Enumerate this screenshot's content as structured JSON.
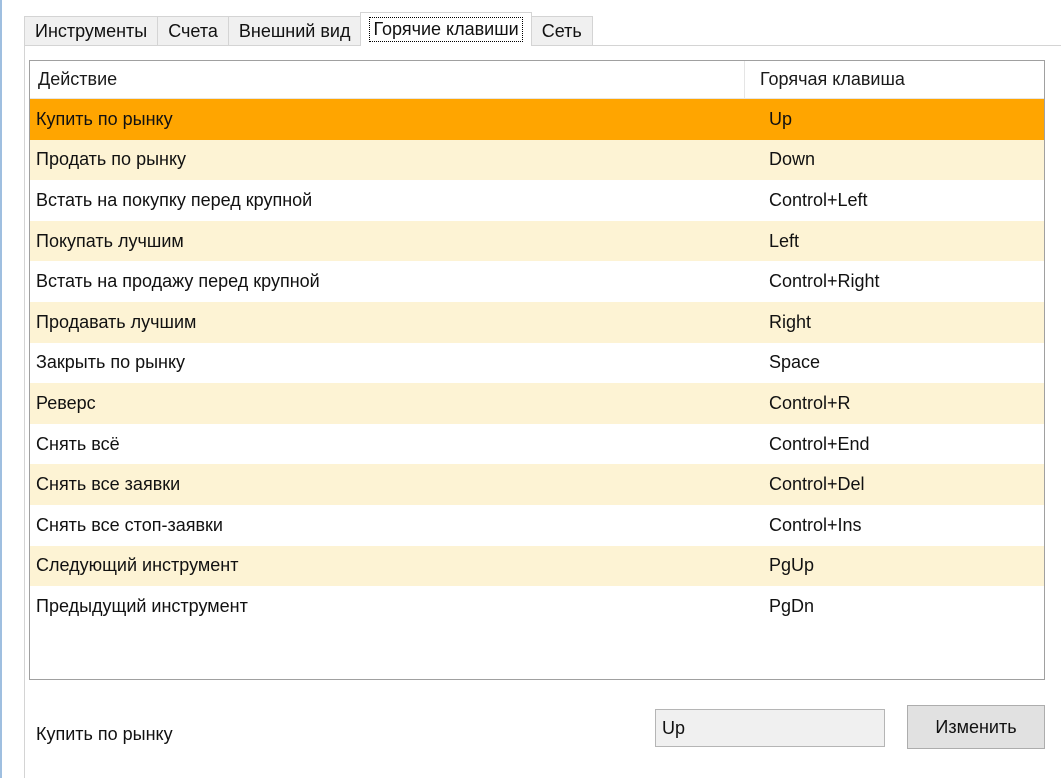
{
  "tabs": [
    {
      "label": "Инструменты",
      "active": false
    },
    {
      "label": "Счета",
      "active": false
    },
    {
      "label": "Внешний вид",
      "active": false
    },
    {
      "label": "Горячие клавиши",
      "active": true
    },
    {
      "label": "Сеть",
      "active": false
    }
  ],
  "table": {
    "headers": {
      "action": "Действие",
      "hotkey": "Горячая клавиша"
    },
    "selected_index": 0,
    "rows": [
      {
        "action": "Купить по рынку",
        "hotkey": "Up"
      },
      {
        "action": "Продать по рынку",
        "hotkey": "Down"
      },
      {
        "action": "Встать на покупку перед крупной",
        "hotkey": "Control+Left"
      },
      {
        "action": "Покупать лучшим",
        "hotkey": "Left"
      },
      {
        "action": "Встать на продажу перед крупной",
        "hotkey": "Control+Right"
      },
      {
        "action": "Продавать лучшим",
        "hotkey": "Right"
      },
      {
        "action": "Закрыть по рынку",
        "hotkey": "Space"
      },
      {
        "action": "Реверс",
        "hotkey": "Control+R"
      },
      {
        "action": "Снять всё",
        "hotkey": "Control+End"
      },
      {
        "action": "Снять все заявки",
        "hotkey": "Control+Del"
      },
      {
        "action": "Снять все стоп-заявки",
        "hotkey": "Control+Ins"
      },
      {
        "action": "Следующий инструмент",
        "hotkey": "PgUp"
      },
      {
        "action": "Предыдущий инструмент",
        "hotkey": "PgDn"
      }
    ]
  },
  "editor": {
    "action_label": "Купить по рынку",
    "hotkey_value": "Up",
    "change_button": "Изменить"
  },
  "colors": {
    "selected_row": "#ffa500",
    "alt_row": "#fdf3d4"
  }
}
